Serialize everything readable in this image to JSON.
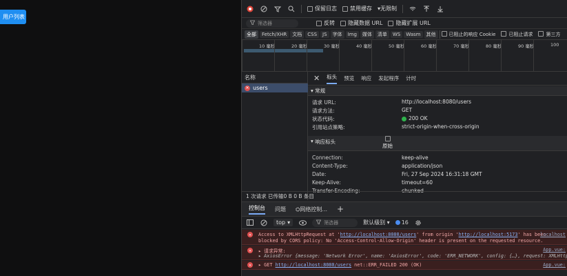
{
  "page": {
    "button_label": "用户列表"
  },
  "toolbar": {
    "preserve_log": "保留日志",
    "disable_cache": "禁用缓存",
    "throttle": "无限制"
  },
  "filter_bar": {
    "placeholder": "筛选器",
    "invert": "反转",
    "hide_data_urls": "隐藏数据 URL",
    "hide_ext_urls": "隐藏扩展 URL"
  },
  "type_filters": [
    "全部",
    "Fetch/XHR",
    "文档",
    "CSS",
    "JS",
    "字体",
    "Img",
    "媒体",
    "清单",
    "WS",
    "Wasm",
    "其他"
  ],
  "type_extra": {
    "blocked_cookies": "已阻止的响应 Cookie",
    "blocked_requests": "已阻止请求",
    "third_party": "第三方"
  },
  "timeline": {
    "ticks": [
      "10 毫秒",
      "20 毫秒",
      "30 毫秒",
      "40 毫秒",
      "50 毫秒",
      "60 毫秒",
      "70 毫秒",
      "80 毫秒",
      "90 毫秒",
      "100"
    ]
  },
  "request_list": {
    "header": "名称",
    "items": [
      {
        "name": "users"
      }
    ]
  },
  "details": {
    "tabs": [
      "标头",
      "预览",
      "响应",
      "发起程序",
      "计时"
    ],
    "general_title": "常规",
    "general": [
      {
        "k": "请求 URL:",
        "v": "http://localhost:8080/users"
      },
      {
        "k": "请求方法:",
        "v": "GET"
      },
      {
        "k": "状态代码:",
        "v": "200 OK"
      },
      {
        "k": "引用站点策略:",
        "v": "strict-origin-when-cross-origin"
      }
    ],
    "response_title": "响应标头",
    "raw_label": "原始",
    "response": [
      {
        "k": "Connection:",
        "v": "keep-alive"
      },
      {
        "k": "Content-Type:",
        "v": "application/json"
      },
      {
        "k": "Date:",
        "v": "Fri, 27 Sep 2024 16:31:18 GMT"
      },
      {
        "k": "Keep-Alive:",
        "v": "timeout=60"
      },
      {
        "k": "Transfer-Encoding:",
        "v": "chunked"
      }
    ]
  },
  "summary": "1 次请求  已传输0 B  0 B 条目",
  "drawer": {
    "tabs": [
      "控制台",
      "问题",
      "网络控制..."
    ]
  },
  "console_toolbar": {
    "context": "top",
    "filter_placeholder": "筛选器",
    "level": "默认级别",
    "count": "16"
  },
  "console": {
    "msg1_line1_a": "Access to XMLHttpRequest at '",
    "msg1_url1": "http://localhost:8080/users",
    "msg1_line1_b": "' from origin '",
    "msg1_url2": "http://localhost:5173",
    "msg1_line1_c": "' has been",
    "msg1_line2": "blocked by CORS policy: No 'Access-Control-Allow-Origin' header is present on the requested resource.",
    "msg1_src": "localhost",
    "msg2_line1": "▸ 请求异常:",
    "msg2_line2": "▸ AxiosError {message: 'Network Error', name: 'AxiosError', code: 'ERR_NETWORK', config: {…}, request: XMLHttpRequ",
    "msg2_src": "App.vue:",
    "msg3_a": "▸ GET ",
    "msg3_url": "http://localhost:8080/users",
    "msg3_b": " net::ERR_FAILED 200 (OK)",
    "msg3_src": "App.vue:"
  }
}
